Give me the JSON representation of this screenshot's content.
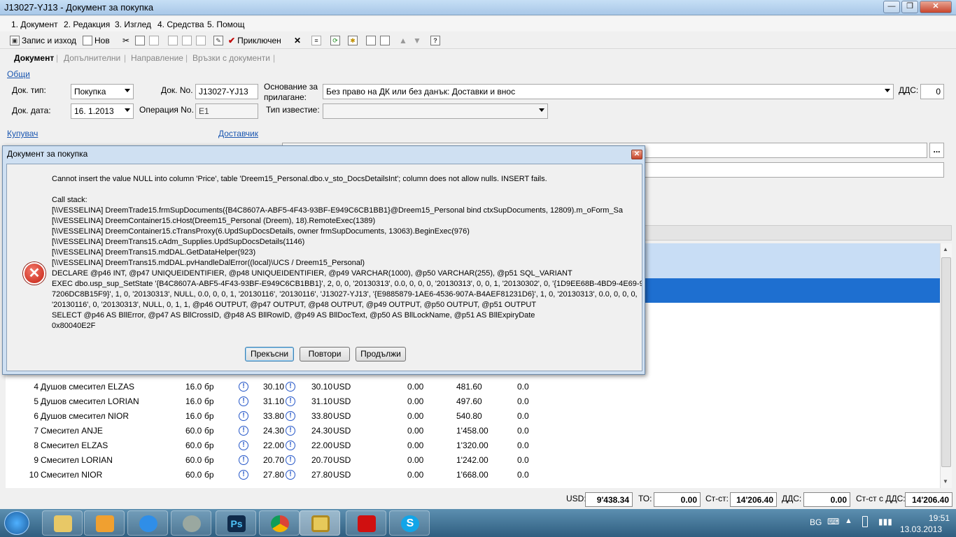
{
  "window": {
    "title": "J13027-YJ13 - Документ за покупка"
  },
  "menu": [
    "1. Документ",
    "2. Редакция",
    "3. Изглед",
    "4. Средства",
    "5. Помощ"
  ],
  "toolbar": {
    "save_exit": "Запис и изход",
    "new": "Нов",
    "done": "Приключен"
  },
  "tabs": [
    "Документ",
    "Допълнителни",
    "Направление",
    "Връзки с документи"
  ],
  "general": {
    "section": "Общи",
    "doc_type_label": "Док. тип:",
    "doc_type": "Покупка",
    "doc_no_label": "Док. No.",
    "doc_no": "J13027-YJ13",
    "basis_label_1": "Основание за",
    "basis_label_2": "прилагане:",
    "basis": "Без право на ДК или без данък: Доставки и внос",
    "vat_label": "ДДС:",
    "vat": "0",
    "doc_date_label": "Док. дата:",
    "doc_date": "16. 1.2013",
    "op_no_label": "Операция No.",
    "op_no": "E1",
    "notice_type_label": "Тип известие:",
    "notice_type": ""
  },
  "buyer": {
    "section": "Купувач"
  },
  "supplier": {
    "section": "Доставчик",
    "browse": "..."
  },
  "items": [
    {
      "n": "4",
      "name": "Душов смесител ELZAS",
      "qty": "16.0",
      "unit": "бр",
      "price": "30.10",
      "price2": "30.10",
      "cur": "USD",
      "disc": "0.00",
      "total": "481.60",
      "vat": "0.0"
    },
    {
      "n": "5",
      "name": "Душов смесител LORIAN",
      "qty": "16.0",
      "unit": "бр",
      "price": "31.10",
      "price2": "31.10",
      "cur": "USD",
      "disc": "0.00",
      "total": "497.60",
      "vat": "0.0"
    },
    {
      "n": "6",
      "name": "Душов смесител NIOR",
      "qty": "16.0",
      "unit": "бр",
      "price": "33.80",
      "price2": "33.80",
      "cur": "USD",
      "disc": "0.00",
      "total": "540.80",
      "vat": "0.0"
    },
    {
      "n": "7",
      "name": "Смесител ANJE",
      "qty": "60.0",
      "unit": "бр",
      "price": "24.30",
      "price2": "24.30",
      "cur": "USD",
      "disc": "0.00",
      "total": "1'458.00",
      "vat": "0.0"
    },
    {
      "n": "8",
      "name": "Смесител ELZAS",
      "qty": "60.0",
      "unit": "бр",
      "price": "22.00",
      "price2": "22.00",
      "cur": "USD",
      "disc": "0.00",
      "total": "1'320.00",
      "vat": "0.0"
    },
    {
      "n": "9",
      "name": "Смесител LORIAN",
      "qty": "60.0",
      "unit": "бр",
      "price": "20.70",
      "price2": "20.70",
      "cur": "USD",
      "disc": "0.00",
      "total": "1'242.00",
      "vat": "0.0"
    },
    {
      "n": "10",
      "name": "Смесител NIOR",
      "qty": "60.0",
      "unit": "бр",
      "price": "27.80",
      "price2": "27.80",
      "cur": "USD",
      "disc": "0.00",
      "total": "1'668.00",
      "vat": "0.0"
    }
  ],
  "totals": {
    "usd_label": "USD:",
    "usd": "9'438.34",
    "to_label": "ТО:",
    "to": "0.00",
    "value_label": "Ст-ст:",
    "value": "14'206.40",
    "vat_label": "ДДС:",
    "vat": "0.00",
    "value_vat_label": "Ст-ст с ДДС:",
    "value_vat": "14'206.40"
  },
  "dialog": {
    "title": "Документ за покупка",
    "message": "Cannot insert the value NULL into column 'Price', table 'Dreem15_Personal.dbo.v_sto_DocsDetailsInt'; column does not allow nulls. INSERT fails.\n\nCall stack:\n[\\\\VESSELINA] DreemTrade15.frmSupDocuments({B4C8607A-ABF5-4F43-93BF-E949C6CB1BB1}@Dreem15_Personal bind ctxSupDocuments, 12809).m_oForm_Sa\n[\\\\VESSELINA] DreemContainer15.cHost(Dreem15_Personal (Dreem), 18).RemoteExec(1389)\n[\\\\VESSELINA] DreemContainer15.cTransProxy(6.UpdSupDocsDetails, owner frmSupDocuments, 13063).BeginExec(976)\n[\\\\VESSELINA] DreemTrans15.cAdm_Supplies.UpdSupDocsDetails(1146)\n[\\\\VESSELINA] DreemTrans15.mdDAL.GetDataHelper(923)\n[\\\\VESSELINA] DreemTrans15.mdDAL.pvHandleDalError((local)\\UCS / Dreem15_Personal)\nDECLARE @p46 INT, @p47 UNIQUEIDENTIFIER, @p48 UNIQUEIDENTIFIER, @p49 VARCHAR(1000), @p50 VARCHAR(255), @p51 SQL_VARIANT\nEXEC dbo.usp_sup_SetState '{B4C8607A-ABF5-4F43-93BF-E949C6CB1BB1}', 2, 0, 0, '20130313', 0.0, 0, 0, 0, '20130313', 0, 0, 1, '20130302', 0, '{1D9EE68B-4BD9-4E69-9\n7206DC8B15F9}', 1, 0, '20130313', NULL, 0.0, 0, 0, 1, '20130116', '20130116', 'J13027-YJ13', '{E9885879-1AE6-4536-907A-B4AEF81231D6}', 1, 0, '20130313', 0.0, 0, 0, 0,\n'20130116', 0, '20130313', NULL, 0, 1, 1, @p46 OUTPUT, @p47 OUTPUT, @p48 OUTPUT, @p49 OUTPUT, @p50 OUTPUT, @p51 OUTPUT\nSELECT @p46 AS BllError, @p47 AS BllCrossID, @p48 AS BllRowID, @p49 AS BllDocText, @p50 AS BllLockName, @p51 AS BllExpiryDate\n0x80040E2F",
    "abort": "Прекъсни",
    "retry": "Повтори",
    "continue": "Продължи"
  },
  "taskbar": {
    "lang": "BG",
    "time": "19:51",
    "date": "13.03.2013"
  }
}
